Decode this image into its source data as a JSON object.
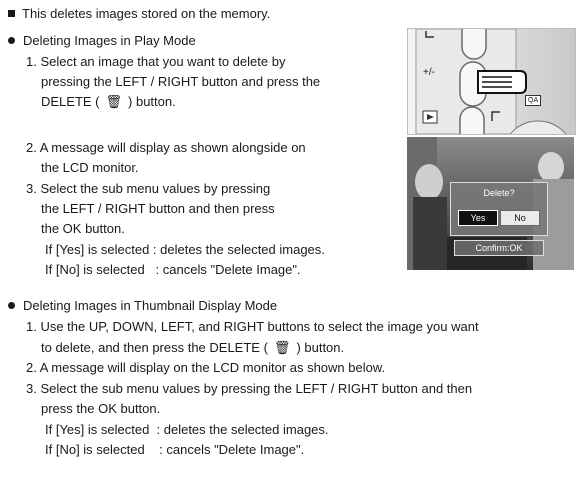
{
  "intro": "This deletes images stored on the memory.",
  "play_mode": {
    "heading": "Deleting Images in Play Mode",
    "step1_a": "1. Select an image that you want to delete by",
    "step1_b": "pressing the LEFT / RIGHT button and press the",
    "step1_c_pre": "DELETE (",
    "step1_c_post": ") button.",
    "step2_a": "2. A message will display as shown alongside on",
    "step2_b": "the LCD monitor.",
    "step3_a": "3. Select the sub menu values by pressing",
    "step3_b": "the LEFT / RIGHT button and then press",
    "step3_c": "the OK button.",
    "yes_note": "If [Yes] is selected : deletes the selected images.",
    "no_note": "If [No] is selected   : cancels \"Delete Image\"."
  },
  "thumb_mode": {
    "heading": "Deleting Images in Thumbnail Display Mode",
    "step1_a": "1. Use the UP, DOWN, LEFT, and RIGHT buttons to select the image you want",
    "step1_b_pre": "to delete, and then press the DELETE (",
    "step1_b_post": ") button.",
    "step2": "2. A message will display on the LCD monitor as shown below.",
    "step3_a": "3. Select the sub menu values by pressing the LEFT / RIGHT button and then",
    "step3_b": "press the OK button.",
    "yes_note": "If [Yes] is selected  : deletes the selected images.",
    "no_note": "If [No] is selected    : cancels \"Delete Image\"."
  },
  "camera_panel": {
    "plus_minus": "+/-",
    "qa_label": "QA"
  },
  "lcd_dialog": {
    "title": "Delete?",
    "yes": "Yes",
    "no": "No",
    "confirm": "Confirm:OK"
  },
  "icons": [
    "bullet-square",
    "bullet-dot",
    "trash-icon",
    "hand-pointer-icon",
    "play-icon",
    "print-icon"
  ]
}
